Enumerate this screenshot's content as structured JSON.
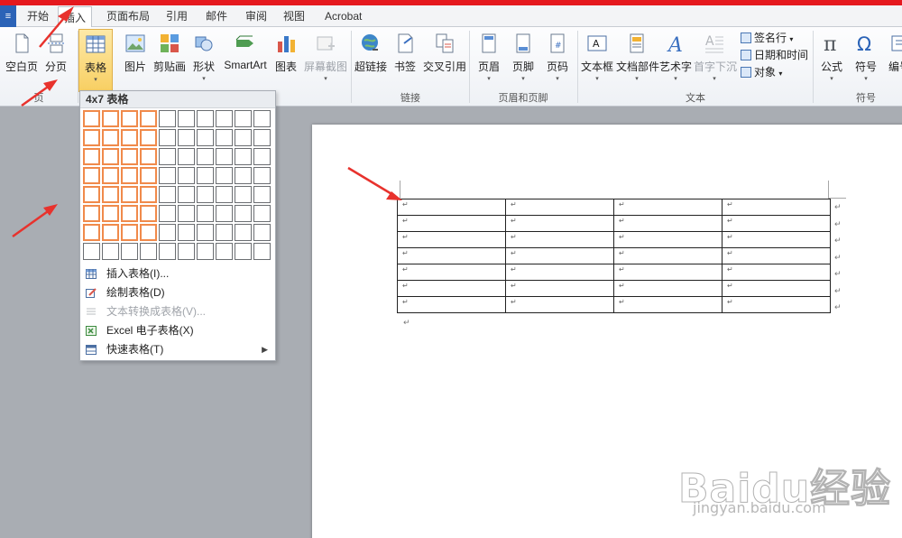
{
  "tabs": [
    {
      "label": "开始"
    },
    {
      "label": "插入"
    },
    {
      "label": "页面布局"
    },
    {
      "label": "引用"
    },
    {
      "label": "邮件"
    },
    {
      "label": "审阅"
    },
    {
      "label": "视图"
    },
    {
      "label": "Acrobat"
    }
  ],
  "ribbon": {
    "buttons": [
      {
        "label": "空白页"
      },
      {
        "label": "分页"
      },
      {
        "label": "表格"
      },
      {
        "label": "图片"
      },
      {
        "label": "剪贴画"
      },
      {
        "label": "形状"
      },
      {
        "label": "SmartArt"
      },
      {
        "label": "图表"
      },
      {
        "label": "屏幕截图"
      },
      {
        "label": "超链接"
      },
      {
        "label": "书签"
      },
      {
        "label": "交叉引用"
      },
      {
        "label": "页眉"
      },
      {
        "label": "页脚"
      },
      {
        "label": "页码"
      },
      {
        "label": "文本框"
      },
      {
        "label": "文档部件"
      },
      {
        "label": "艺术字"
      },
      {
        "label": "首字下沉"
      },
      {
        "label": "公式"
      },
      {
        "label": "符号"
      },
      {
        "label": "编号"
      }
    ],
    "small_buttons": [
      {
        "label": "签名行"
      },
      {
        "label": "日期和时间"
      },
      {
        "label": "对象"
      }
    ],
    "groups": [
      {
        "label": "页"
      },
      {
        "label": "链接"
      },
      {
        "label": "页眉和页脚"
      },
      {
        "label": "文本"
      },
      {
        "label": "符号"
      }
    ]
  },
  "table_dropdown": {
    "title": "4x7 表格",
    "grid_cols": 10,
    "grid_rows": 8,
    "selected_cols": 4,
    "selected_rows": 7,
    "menu_items": [
      {
        "label": "插入表格(I)...",
        "enabled": true
      },
      {
        "label": "绘制表格(D)",
        "enabled": true
      },
      {
        "label": "文本转换成表格(V)...",
        "enabled": false
      },
      {
        "label": "Excel 电子表格(X)",
        "enabled": true
      },
      {
        "label": "快速表格(T)",
        "enabled": true
      }
    ]
  },
  "document_table": {
    "rows": 7,
    "cols": 4,
    "cell_mark": "↵"
  },
  "watermark": {
    "logo": "Baidu经验",
    "url": "jingyan.baidu.com"
  },
  "colors": {
    "accent_red": "#e5191e",
    "highlight_orange": "#f08a4b",
    "pressed_yellow": "#f8cf62",
    "arrow_red": "#e8322d"
  }
}
